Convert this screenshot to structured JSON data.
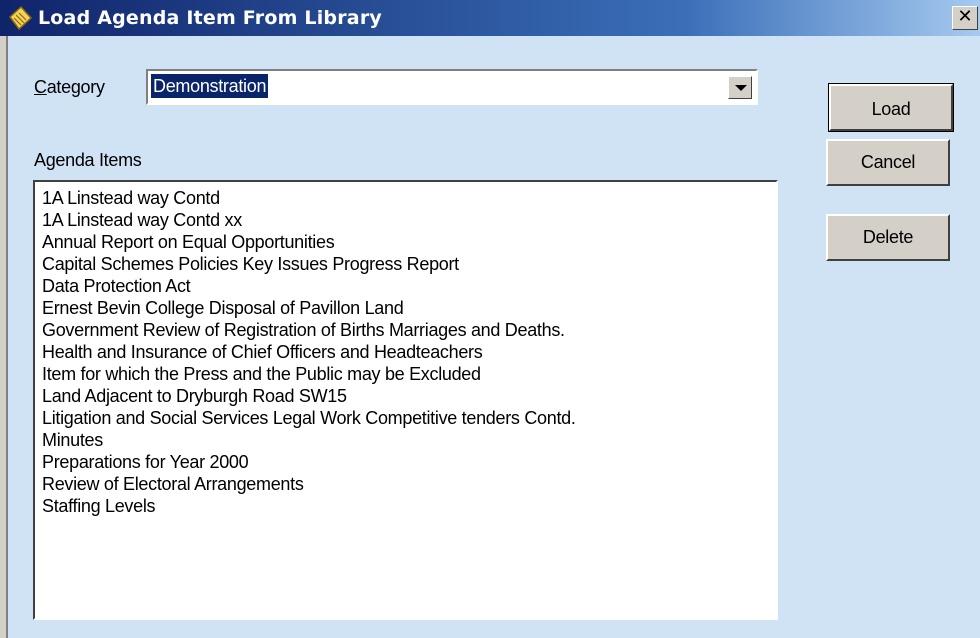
{
  "window": {
    "title": "Load Agenda Item From Library",
    "close_label": "✕"
  },
  "form": {
    "category_label_access": "C",
    "category_label_rest": "ategory",
    "category_value": "Demonstration",
    "items_label": "Agenda Items"
  },
  "agenda_items": [
    "1A Linstead way Contd",
    "1A Linstead way Contd xx",
    "Annual Report on Equal Opportunities",
    "Capital Schemes Policies Key Issues Progress Report",
    "Data Protection Act",
    "Ernest Bevin College  Disposal of Pavillon Land",
    "Government Review of Registration of Births Marriages and Deaths.",
    "Health and Insurance of Chief Officers and Headteachers",
    "Item for which the Press and the Public may be Excluded",
    "Land Adjacent to Dryburgh Road SW15",
    "Litigation and Social Services Legal Work  Competitive tenders Contd.",
    "Minutes",
    "Preparations for Year 2000",
    "Review of Electoral Arrangements",
    "Staffing Levels"
  ],
  "buttons": {
    "load": "Load",
    "cancel": "Cancel",
    "delete": "Delete"
  }
}
